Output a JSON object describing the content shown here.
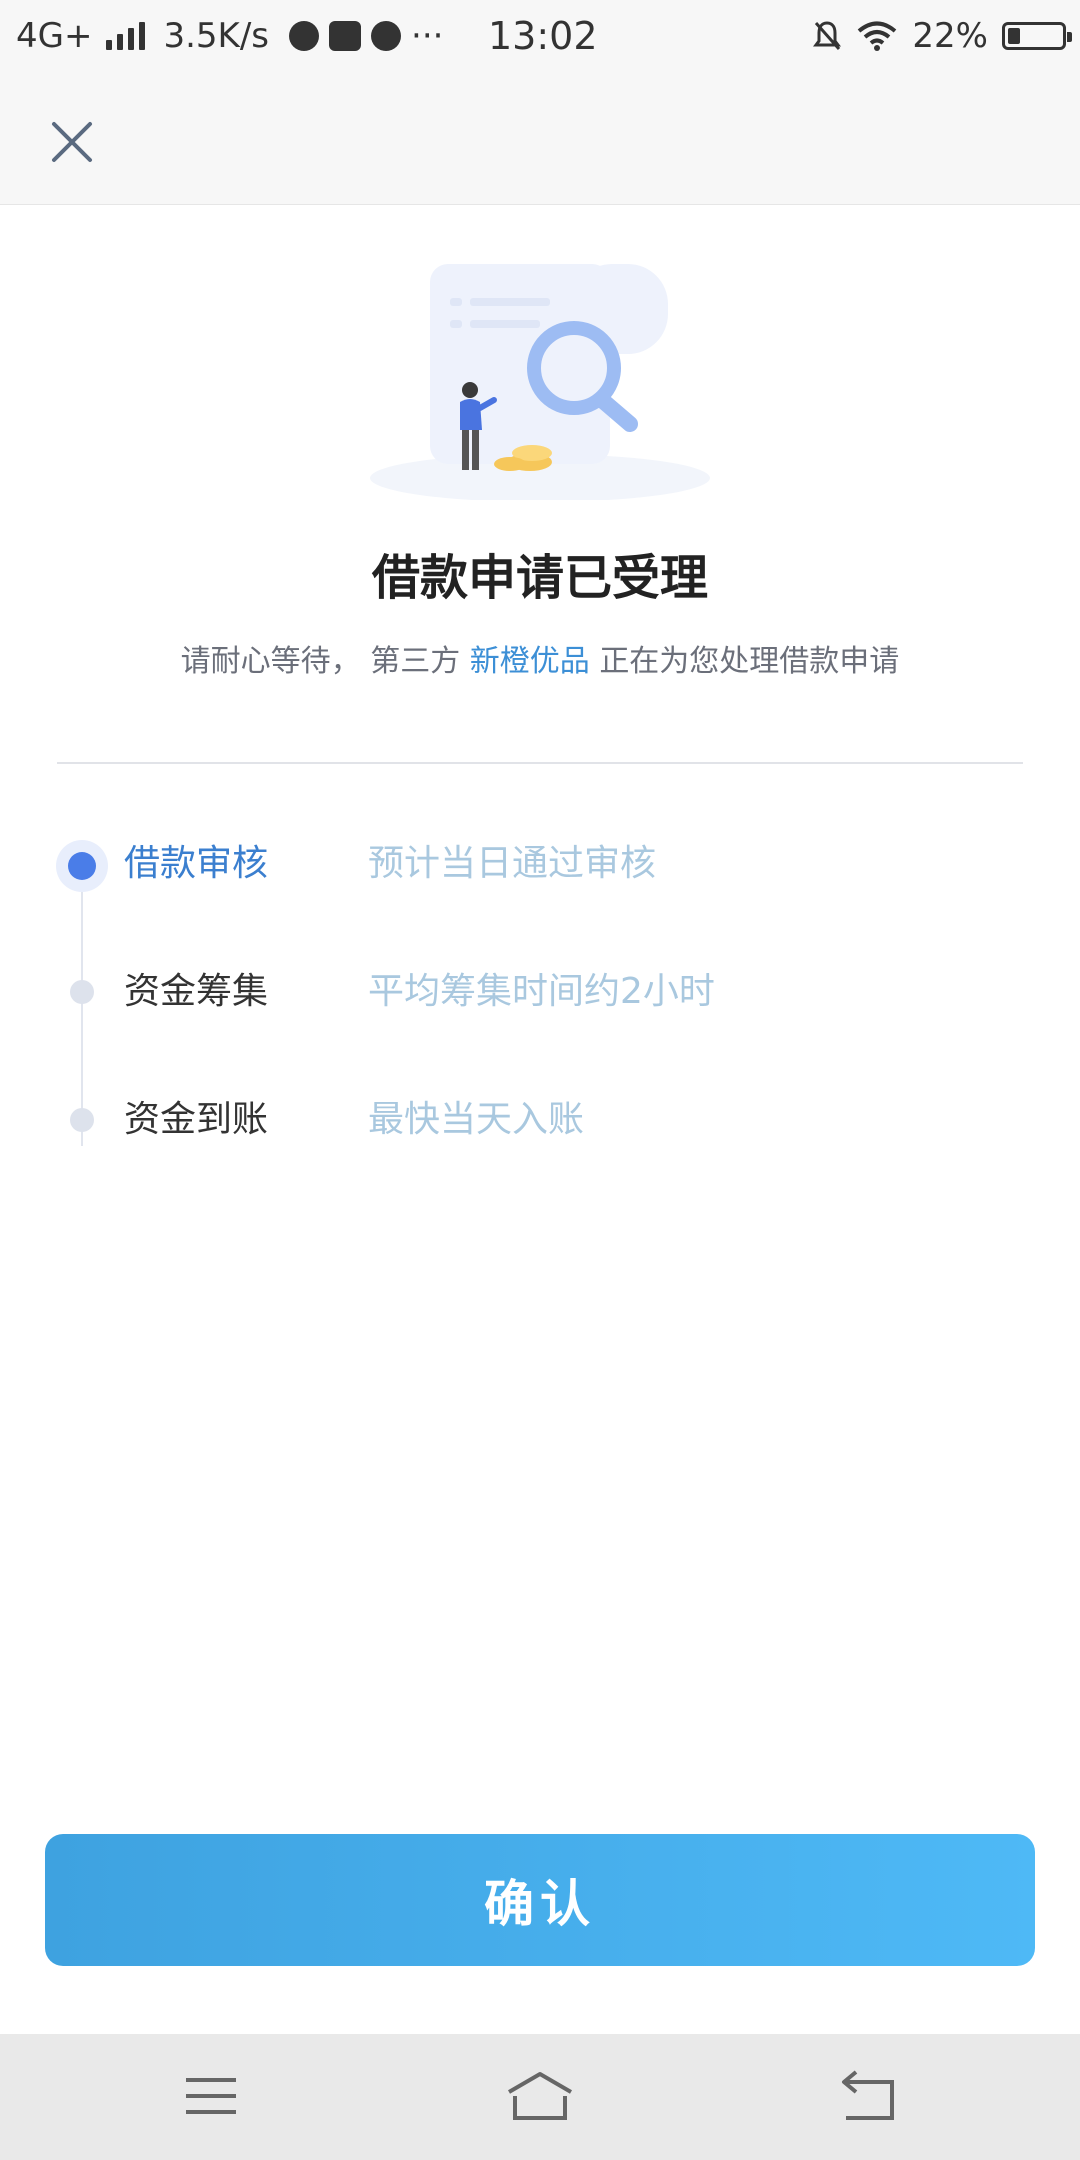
{
  "status_bar": {
    "network": "4G+",
    "speed": "3.5K/s",
    "more": "···",
    "time": "13:02",
    "battery": "22%"
  },
  "header": {
    "close_icon": "close-icon"
  },
  "result": {
    "title": "借款申请已受理",
    "subtitle_prefix": "请耐心等待， 第三方",
    "subtitle_brand": "新橙优品",
    "subtitle_suffix": "正在为您处理借款申请"
  },
  "steps": [
    {
      "label": "借款审核",
      "desc": "预计当日通过审核",
      "active": true
    },
    {
      "label": "资金筹集",
      "desc": "平均筹集时间约2小时",
      "active": false
    },
    {
      "label": "资金到账",
      "desc": "最快当天入账",
      "active": false
    }
  ],
  "confirm_button": {
    "label": "确认"
  },
  "colors": {
    "accent": "#3c8fd6",
    "button_start": "#3ea2e0",
    "button_end": "#4eb9f6",
    "active_dot": "#4a7de8",
    "step_desc": "#a9c8df"
  },
  "nav_bar": {
    "icons": [
      "menu-icon",
      "home-icon",
      "back-icon"
    ]
  }
}
